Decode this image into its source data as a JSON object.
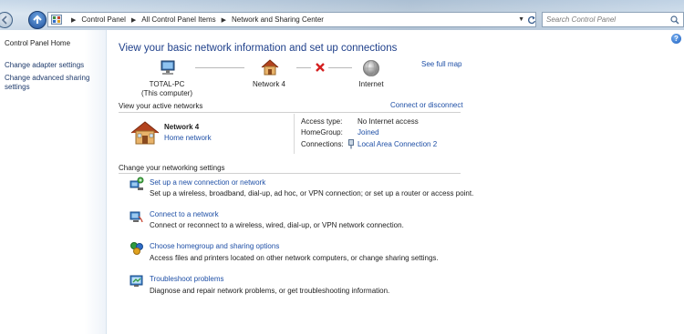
{
  "address_bar": {
    "crumbs": [
      "Control Panel",
      "All Control Panel Items",
      "Network and Sharing Center"
    ]
  },
  "search": {
    "placeholder": "Search Control Panel"
  },
  "left_pane": {
    "home": "Control Panel Home",
    "links": [
      "Change adapter settings",
      "Change advanced sharing settings"
    ]
  },
  "main": {
    "heading": "View your basic network information and set up connections",
    "see_full_map": "See full map",
    "map": {
      "computer_name": "TOTAL-PC",
      "computer_sub": "(This computer)",
      "network_name": "Network  4",
      "internet": "Internet"
    },
    "active_networks": {
      "label": "View your active networks",
      "connect_link": "Connect or disconnect",
      "network_name": "Network  4",
      "network_type": "Home network",
      "properties": [
        {
          "label": "Access type:",
          "value": "No Internet access",
          "link": false
        },
        {
          "label": "HomeGroup:",
          "value": "Joined",
          "link": true
        },
        {
          "label": "Connections:",
          "value": "Local Area Connection 2",
          "link": true
        }
      ]
    },
    "settings": {
      "label": "Change your networking settings",
      "tasks": [
        {
          "title": "Set up a new connection or network",
          "desc": "Set up a wireless, broadband, dial-up, ad hoc, or VPN connection; or set up a router or access point."
        },
        {
          "title": "Connect to a network",
          "desc": "Connect or reconnect to a wireless, wired, dial-up, or VPN network connection."
        },
        {
          "title": "Choose homegroup and sharing options",
          "desc": "Access files and printers located on other network computers, or change sharing settings."
        },
        {
          "title": "Troubleshoot problems",
          "desc": "Diagnose and repair network problems, or get troubleshooting information."
        }
      ]
    }
  },
  "icons": {
    "back": "back-arrow-icon",
    "forward": "forward-arrow-icon",
    "help": "help-icon",
    "computer": "computer-icon",
    "house": "house-icon",
    "globe": "globe-icon",
    "disconnect": "red-x-icon",
    "search": "search-icon"
  },
  "colors": {
    "link": "#1e4fa6",
    "heading": "#1e3f8a",
    "error_x": "#d42020"
  }
}
